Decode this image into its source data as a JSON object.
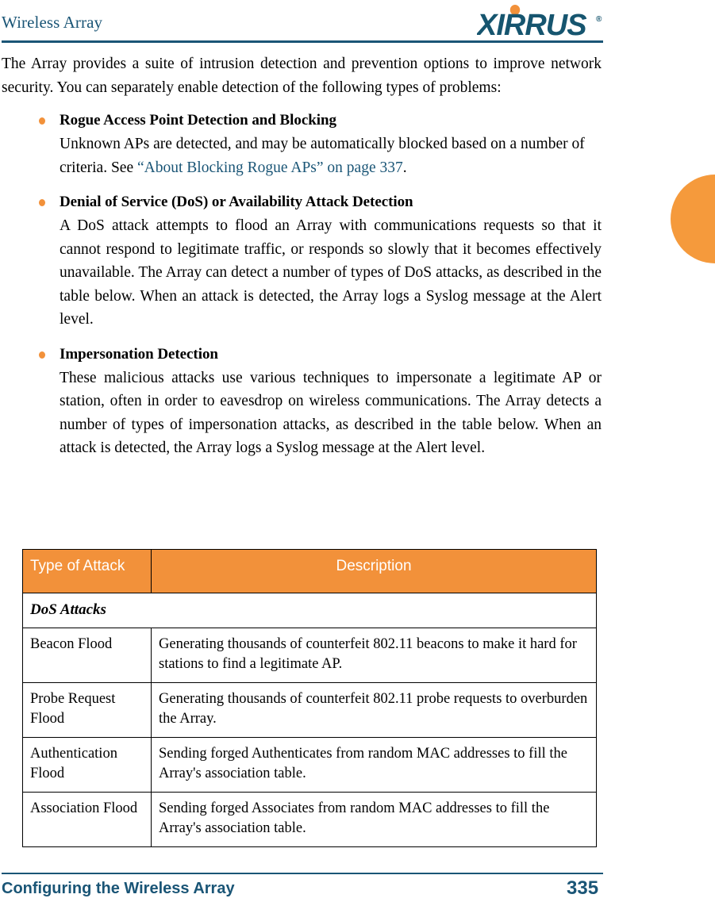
{
  "header": {
    "title": "Wireless Array",
    "logo_text": "XIRRUS",
    "logo_trademark": "®",
    "brand_teal": "#1a5576",
    "brand_orange": "#F2913A"
  },
  "intro": {
    "paragraph": "The Array provides a suite of intrusion detection and prevention options to improve network security. You can separately enable detection of the following types of problems:"
  },
  "bullets": [
    {
      "heading": "Rogue Access Point Detection and Blocking",
      "body_before": "Unknown APs are detected, and may be automatically blocked based on a number of criteria. See ",
      "link": "“About Blocking Rogue APs” on page 337",
      "body_after": "."
    },
    {
      "heading": "Denial of Service (DoS) or Availability Attack Detection",
      "body": "A DoS attack attempts to flood an Array with communications requests so that it cannot respond to legitimate traffic, or responds so slowly that it becomes effectively unavailable. The Array can detect a number of types of DoS attacks, as described in the table below. When an attack is detected, the Array logs a Syslog message at the Alert level."
    },
    {
      "heading": "Impersonation Detection",
      "body": "These malicious attacks use various techniques to impersonate a legitimate AP or station, often in order to eavesdrop on wireless communications. The Array detects a number of types of impersonation attacks, as described in the table below. When an attack is detected, the Array logs a Syslog message at the Alert level."
    }
  ],
  "table": {
    "columns": [
      "Type of Attack",
      "Description"
    ],
    "groups": [
      {
        "label": "DoS Attacks",
        "rows": [
          {
            "type": "Beacon Flood",
            "description": "Generating thousands of counterfeit 802.11 beacons to make it hard for stations to find a legitimate AP."
          },
          {
            "type": "Probe Request Flood",
            "description": "Generating thousands of counterfeit 802.11 probe requests to overburden the Array."
          },
          {
            "type": "Authentication Flood",
            "description": "Sending forged Authenticates from random MAC addresses to fill the Array's association table."
          },
          {
            "type": "Association Flood",
            "description": "Sending forged Associates from random MAC addresses to fill the Array's association table."
          }
        ]
      }
    ]
  },
  "footer": {
    "text": "Configuring the Wireless Array",
    "page_number": "335"
  }
}
